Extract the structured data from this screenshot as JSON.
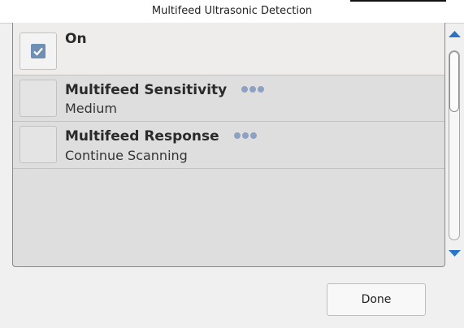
{
  "dialog": {
    "title": "Multifeed Ultrasonic Detection"
  },
  "options": [
    {
      "label": "On",
      "value": "",
      "checked": true
    },
    {
      "label": "Multifeed Sensitivity",
      "value": "Medium",
      "checked": false
    },
    {
      "label": "Multifeed Response",
      "value": "Continue Scanning",
      "checked": false
    }
  ],
  "footer": {
    "done_label": "Done"
  },
  "colors": {
    "accent": "#6f8fb5",
    "arrow": "#2b74c4",
    "dots": "#8ea1c2"
  },
  "icons": {
    "check": "checkmark-icon",
    "more": "more-dots-icon",
    "up": "up-arrow-icon",
    "down": "down-arrow-icon"
  }
}
